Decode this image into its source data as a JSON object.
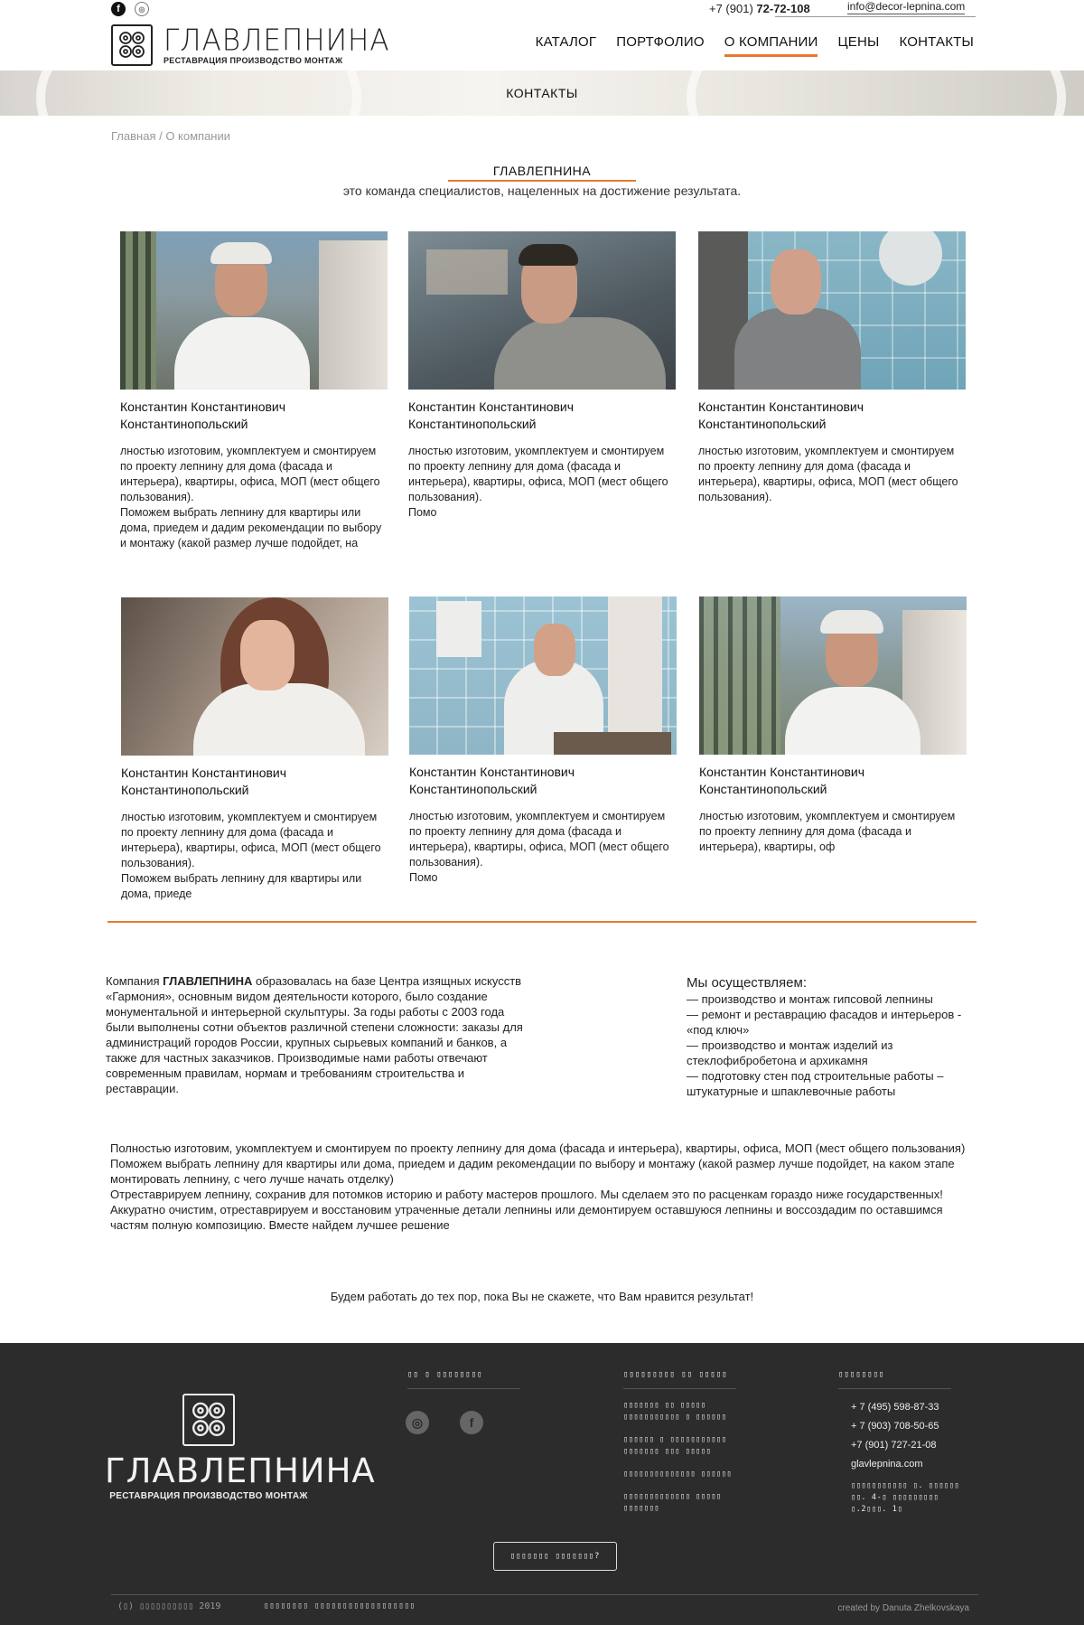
{
  "header": {
    "phone_prefix": "+7 (901) ",
    "phone_number": "72-72-108",
    "email": "info@decor-lepnina.com",
    "logo_name": "ГЛАВЛЕПНИНА",
    "logo_tagline": "РЕСТАВРАЦИЯ ПРОИЗВОДСТВО МОНТАЖ",
    "nav": [
      {
        "label": "КАТАЛОГ"
      },
      {
        "label": "ПОРТФОЛИО"
      },
      {
        "label": "О КОМПАНИИ",
        "active": true
      },
      {
        "label": "ЦЕНЫ"
      },
      {
        "label": "КОНТАКТЫ"
      }
    ]
  },
  "banner": {
    "title": "КОНТАКТЫ"
  },
  "breadcrumb": "Главная / О компании",
  "intro": {
    "title": "ГЛАВЛЕПНИНА",
    "subtitle": "это команда специалистов, нацеленных на достижение результата."
  },
  "team": [
    {
      "name": "Константин Константинович Константинопольский",
      "text": "лностью изготовим, укомплектуем и смонтируем по проекту лепнину для дома (фасада и интерьера), квартиры, офиса, МОП (мест общего пользования).\nПоможем выбрать лепнину для квартиры или дома, приедем и дадим рекомендации по выбору и монтажу (какой размер лучше подойдет, на"
    },
    {
      "name": "Константин Константинович Константинопольский",
      "text": "лностью изготовим, укомплектуем и смонтируем по проекту лепнину для дома (фасада и интерьера), квартиры, офиса, МОП (мест общего пользования).\nПомо"
    },
    {
      "name": "Константин Константинович Константинопольский",
      "text": "лностью изготовим, укомплектуем и смонтируем по проекту лепнину для дома (фасада и интерьера), квартиры, офиса, МОП (мест общего пользования)."
    },
    {
      "name": "Константин Константинович Константинопольский",
      "text": "лностью изготовим, укомплектуем и смонтируем по проекту лепнину для дома (фасада и интерьера), квартиры, офиса, МОП (мест общего пользования).\nПоможем выбрать лепнину для квартиры или дома, приеде"
    },
    {
      "name": "Константин Константинович Константинопольский",
      "text": "лностью изготовим, укомплектуем и смонтируем по проекту лепнину для дома (фасада и интерьера), квартиры, офиса, МОП (мест общего пользования).\nПомо"
    },
    {
      "name": "Константин Константинович Константинопольский",
      "text": "лностью изготовим, укомплектуем и смонтируем по проекту лепнину для дома (фасада и интерьера), квартиры, оф"
    }
  ],
  "about": {
    "company_prefix": "Компания ",
    "company_name": "ГЛАВЛЕПНИНА",
    "company_text": " образовалась на базе Центра изящных искусств «Гармония», основным видом деятельности которого, было создание монументальной и интерьерной скульптуры. За годы работы с 2003 года были выполнены сотни объектов различной степени сложности: заказы для администраций городов России, крупных сырьевых компаний и банков, а также для частных заказчиков. Производимые нами работы отвечают современным правилам, нормам и требованиям строительства и реставрации.",
    "we_do_title": "Мы осуществляем:",
    "we_do": [
      "— производство и монтаж гипсовой лепнины",
      "— ремонт и реставрацию фасадов и интерьеров - «под ключ»",
      "— производство и монтаж изделий из стеклофибробетона и архикамня",
      "— подготовку стен под строительные работы – штукатурные и шпаклевочные работы"
    ],
    "services": "Полностью изготовим, укомплектуем и смонтируем по проекту лепнину для дома (фасада и интерьера), квартиры, офиса, МОП (мест общего пользования)\nПоможем выбрать лепнину для квартиры или дома, приедем и дадим рекомендации по выбору и монтажу (какой размер лучше подойдет, на каком этапе монтировать лепнину, с чего лучше начать отделку)\nОтреставрируем лепнину, сохранив для потомков историю и работу мастеров прошлого. Мы сделаем это по расценкам гораздо ниже государственных!\nАккуратно очистим, отреставрируем и восстановим утраченные детали лепнины или демонтируем оставшуюся лепнины и воссоздадим по оставшимся частям полную композицию. Вместе найдем лучшее решение",
    "closing": "Будем работать до тех пор, пока Вы не скажете, что Вам нравится результат!"
  },
  "footer": {
    "logo_name": "ГЛАВЛЕПНИНА",
    "logo_tagline": "РЕСТАВРАЦИЯ ПРОИЗВОДСТВО МОНТАЖ",
    "col1_head": "▯▯ ▯ ▯▯▯▯▯▯▯▯",
    "col2_head": "▯▯▯▯▯▯▯▯▯ ▯▯ ▯▯▯▯▯",
    "col2_links": [
      "▯▯▯▯▯▯▯ ▯▯ ▯▯▯▯▯ ▯▯▯▯▯▯▯▯▯▯▯ ▯ ▯▯▯▯▯▯",
      "▯▯▯▯▯▯ ▯ ▯▯▯▯▯▯▯▯▯▯▯ ▯▯▯▯▯▯▯ ▯▯▯ ▯▯▯▯▯",
      "▯▯▯▯▯▯▯▯▯▯▯▯▯▯ ▯▯▯▯▯▯",
      "▯▯▯▯▯▯▯▯▯▯▯▯▯  ▯▯▯▯▯ ▯▯▯▯▯▯▯"
    ],
    "col3_head": "▯▯▯▯▯▯▯▯",
    "phones": [
      "+ 7 (495) 598-87-33",
      "+ 7 (903) 708-50-65",
      "+7 (901) 727-21-08"
    ],
    "site": "glavlepnina.com",
    "address": "▯▯▯▯▯▯▯▯▯▯▯ ▯. ▯▯▯▯▯▯ ▯▯. 4-▯ ▯▯▯▯▯▯▯▯▯ ▯.2▯▯▯. 1▯",
    "question_button": "▯▯▯▯▯▯▯ ▯▯▯▯▯▯▯?",
    "copyright": "(▯) ▯▯▯▯▯▯▯▯▯▯ 2019",
    "policy": "▯▯▯▯▯▯▯▯ ▯▯▯▯▯▯▯▯▯▯▯▯▯▯▯▯▯▯",
    "credit": "created by Danuta Zhelkovskaya"
  }
}
